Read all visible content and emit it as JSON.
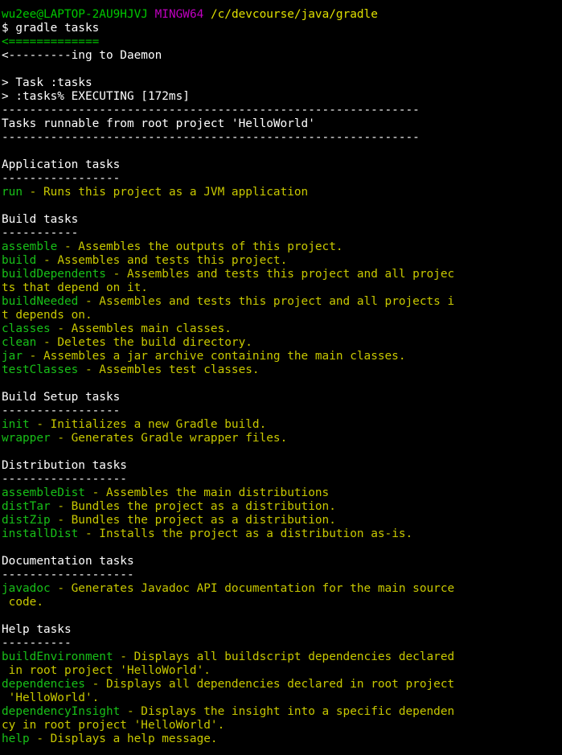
{
  "colors": {
    "background": "#000000",
    "prompt_user": "#00c800",
    "prompt_shell": "#c000c0",
    "prompt_path": "#e0e000",
    "task_name": "#18c018",
    "task_desc": "#c8c800",
    "text": "#ffffff"
  },
  "prompt": {
    "user_host": "wu2ee@LAPTOP-2AU9HJVJ",
    "shell": "MINGW64",
    "path": "/c/devcourse/java/gradle"
  },
  "command": "$ gradle tasks",
  "progress": {
    "bar": "<=============",
    "daemon": "<---------ing to Daemon"
  },
  "status": {
    "task": "> Task :tasks",
    "executing": "> :tasks% EXECUTING [172ms]"
  },
  "divider": "------------------------------------------------------------",
  "header": "Tasks runnable from root project 'HelloWorld'",
  "groups": [
    {
      "title": "Application tasks",
      "underline": "-----------------",
      "tasks": [
        {
          "name": "run",
          "desc": " - Runs this project as a JVM application"
        }
      ]
    },
    {
      "title": "Build tasks",
      "underline": "-----------",
      "tasks": [
        {
          "name": "assemble",
          "desc": " - Assembles the outputs of this project."
        },
        {
          "name": "build",
          "desc": " - Assembles and tests this project."
        },
        {
          "name": "buildDependents",
          "desc": " - Assembles and tests this project and all projec",
          "wrap": "ts that depend on it."
        },
        {
          "name": "buildNeeded",
          "desc": " - Assembles and tests this project and all projects i",
          "wrap": "t depends on."
        },
        {
          "name": "classes",
          "desc": " - Assembles main classes."
        },
        {
          "name": "clean",
          "desc": " - Deletes the build directory."
        },
        {
          "name": "jar",
          "desc": " - Assembles a jar archive containing the main classes."
        },
        {
          "name": "testClasses",
          "desc": " - Assembles test classes."
        }
      ]
    },
    {
      "title": "Build Setup tasks",
      "underline": "-----------------",
      "tasks": [
        {
          "name": "init",
          "desc": " - Initializes a new Gradle build."
        },
        {
          "name": "wrapper",
          "desc": " - Generates Gradle wrapper files."
        }
      ]
    },
    {
      "title": "Distribution tasks",
      "underline": "------------------",
      "tasks": [
        {
          "name": "assembleDist",
          "desc": " - Assembles the main distributions"
        },
        {
          "name": "distTar",
          "desc": " - Bundles the project as a distribution."
        },
        {
          "name": "distZip",
          "desc": " - Bundles the project as a distribution."
        },
        {
          "name": "installDist",
          "desc": " - Installs the project as a distribution as-is."
        }
      ]
    },
    {
      "title": "Documentation tasks",
      "underline": "-------------------",
      "tasks": [
        {
          "name": "javadoc",
          "desc": " - Generates Javadoc API documentation for the main source",
          "wrap": " code."
        }
      ]
    },
    {
      "title": "Help tasks",
      "underline": "----------",
      "tasks": [
        {
          "name": "buildEnvironment",
          "desc": " - Displays all buildscript dependencies declared",
          "wrap": " in root project 'HelloWorld'."
        },
        {
          "name": "dependencies",
          "desc": " - Displays all dependencies declared in root project",
          "wrap": " 'HelloWorld'."
        },
        {
          "name": "dependencyInsight",
          "desc": " - Displays the insight into a specific dependen",
          "wrap": "cy in root project 'HelloWorld'."
        },
        {
          "name": "help",
          "desc": " - Displays a help message."
        }
      ]
    }
  ]
}
